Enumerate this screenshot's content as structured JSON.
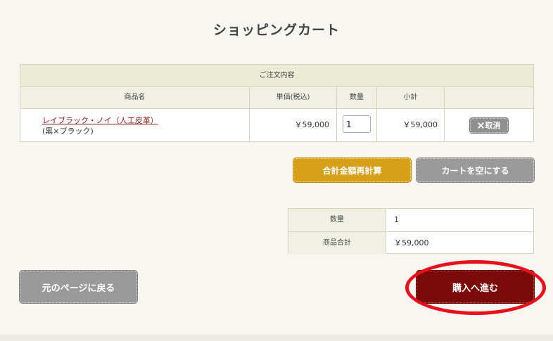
{
  "page": {
    "title": "ショッピングカート"
  },
  "order": {
    "caption": "ご注文内容",
    "headers": {
      "name": "商品名",
      "unit_price": "単価(税込)",
      "quantity": "数量",
      "subtotal": "小計"
    },
    "items": [
      {
        "name": "レイブラック・ノイ（人工皮革）",
        "variant": "(黒×ブラック)",
        "unit_price": "￥59,000",
        "quantity": "1",
        "subtotal": "￥59,000",
        "remove_label": "取消",
        "remove_icon": "close-icon"
      }
    ]
  },
  "actions": {
    "recalc_label": "合計金額再計算",
    "empty_label": "カートを空にする",
    "back_label": "元のページに戻る",
    "checkout_label": "購入へ進む"
  },
  "summary": {
    "quantity_label": "数量",
    "quantity_value": "1",
    "total_label": "商品合計",
    "total_value": "￥59,000"
  },
  "colors": {
    "recalc": "#d6a01b",
    "checkout": "#7d0a0a",
    "highlight": "#e8101a",
    "link": "#8b1a1a"
  }
}
